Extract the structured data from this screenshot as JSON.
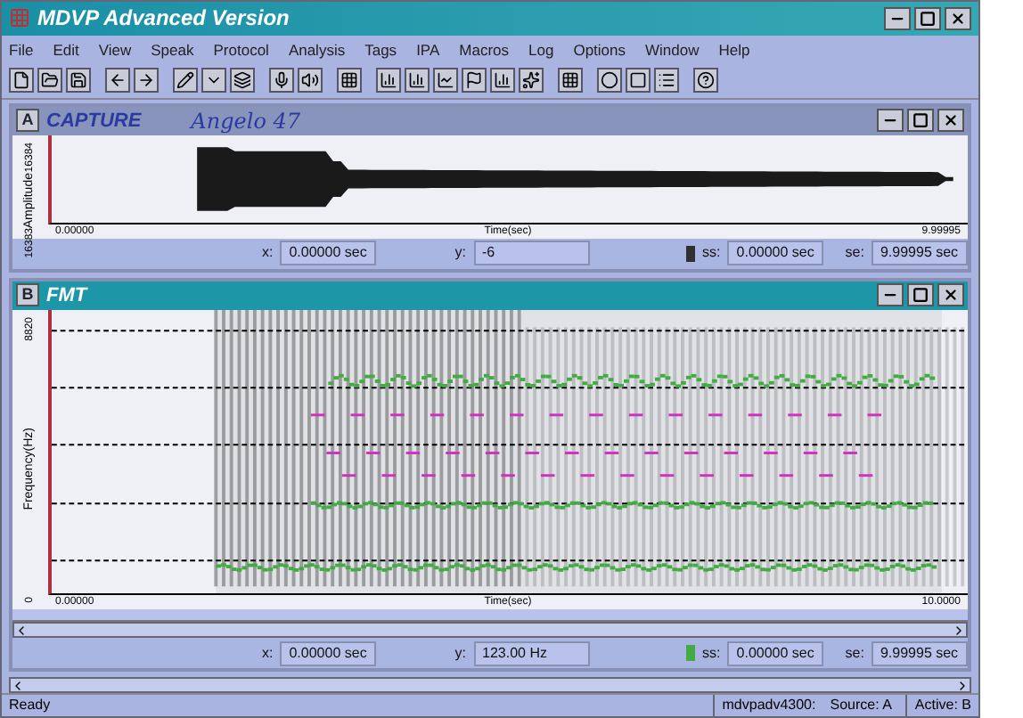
{
  "window": {
    "title": "MDVP Advanced Version"
  },
  "menu": [
    "File",
    "Edit",
    "View",
    "Speak",
    "Protocol",
    "Analysis",
    "Tags",
    "IPA",
    "Macros",
    "Log",
    "Options",
    "Window",
    "Help"
  ],
  "panes": [
    {
      "kind": "wave",
      "badge": "A",
      "title": "CAPTURE",
      "note": "Angelo 47",
      "active": false,
      "ylabel": "Amplitude",
      "yticks": [
        "16384",
        "16383"
      ],
      "xstart": "0.00000",
      "xend": "9.99995",
      "xlabel": "Time(sec)",
      "fields": [
        {
          "label": "x:",
          "value": "0.00000 sec"
        },
        {
          "label": "y:",
          "value": "-6"
        },
        {
          "label": "ss:",
          "value": "0.00000 sec"
        },
        {
          "label": "se:",
          "value": "9.99995 sec"
        }
      ],
      "color": "#303030"
    },
    {
      "kind": "spectro",
      "badge": "B",
      "title": "FMT",
      "active": true,
      "ylabel": "Frequency(Hz)",
      "yticks": [
        "8820",
        "0"
      ],
      "xstart": "0.00000",
      "xend": "10.0000",
      "xlabel": "Time(sec)",
      "fields": [
        {
          "label": "x:",
          "value": "0.00000 sec"
        },
        {
          "label": "y:",
          "value": "123.00 Hz"
        },
        {
          "label": "ss:",
          "value": "0.00000 sec"
        },
        {
          "label": "se:",
          "value": "9.99995 sec"
        }
      ],
      "color": "#44aa44"
    }
  ],
  "status_bar": [
    "Ready",
    "mdvpadv4300:",
    "Source: A",
    "Active: B"
  ]
}
